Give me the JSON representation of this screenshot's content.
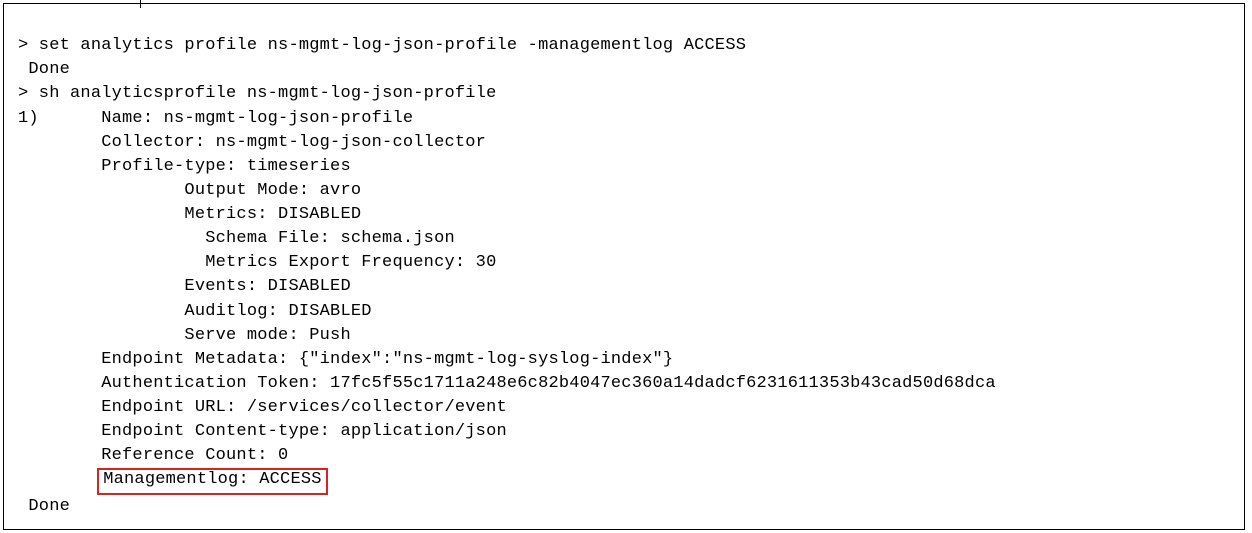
{
  "terminal": {
    "cmd1_prompt": ">",
    "cmd1": " set analytics profile ns-mgmt-log-json-profile -managementlog ACCESS",
    "cmd1_result": " Done",
    "cmd2_prompt": ">",
    "cmd2": " sh analyticsprofile ns-mgmt-log-json-profile",
    "item_index": "1)",
    "name_line": "      Name: ns-mgmt-log-json-profile",
    "collector_line": "        Collector: ns-mgmt-log-json-collector",
    "profiletype_line": "        Profile-type: timeseries",
    "outputmode_line": "                Output Mode: avro",
    "metrics_line": "                Metrics: DISABLED",
    "schemafile_line": "                  Schema File: schema.json",
    "metricsfreq_line": "                  Metrics Export Frequency: 30",
    "events_line": "                Events: DISABLED",
    "auditlog_line": "                Auditlog: DISABLED",
    "servemode_line": "                Serve mode: Push",
    "endpointmeta_line": "        Endpoint Metadata: {\"index\":\"ns-mgmt-log-syslog-index\"}",
    "authtoken_line": "        Authentication Token: 17fc5f55c1711a248e6c82b4047ec360a14dadcf6231611353b43cad50d68dca",
    "endpointurl_line": "        Endpoint URL: /services/collector/event",
    "contenttype_line": "        Endpoint Content-type: application/json",
    "refcount_line": "        Reference Count: 0",
    "mgmtlog_indent": "        ",
    "mgmtlog_line": "Managementlog: ACCESS",
    "done2": " Done"
  }
}
